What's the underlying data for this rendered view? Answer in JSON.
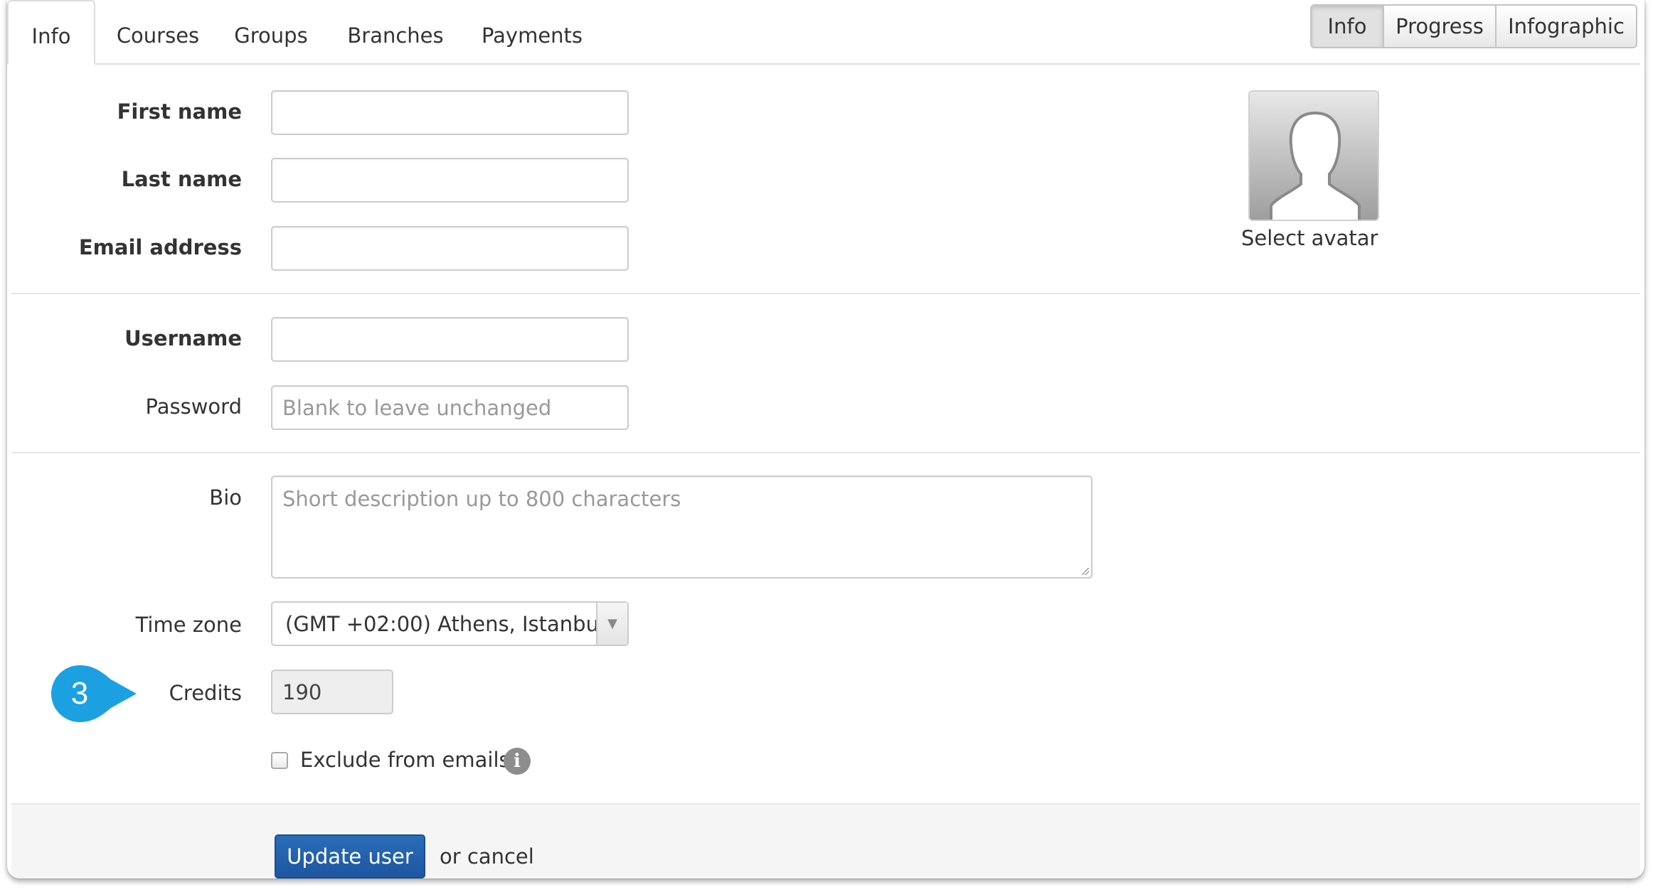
{
  "tabs": [
    {
      "label": "Info",
      "active": true
    },
    {
      "label": "Courses",
      "active": false
    },
    {
      "label": "Groups",
      "active": false
    },
    {
      "label": "Branches",
      "active": false
    },
    {
      "label": "Payments",
      "active": false
    }
  ],
  "view_toggle": [
    {
      "label": "Info",
      "active": true
    },
    {
      "label": "Progress",
      "active": false
    },
    {
      "label": "Infographic",
      "active": false
    }
  ],
  "form": {
    "first_name": {
      "label": "First name",
      "value": ""
    },
    "last_name": {
      "label": "Last name",
      "value": ""
    },
    "email": {
      "label": "Email address",
      "value": ""
    },
    "username": {
      "label": "Username",
      "value": ""
    },
    "password": {
      "label": "Password",
      "placeholder": "Blank to leave unchanged"
    },
    "bio": {
      "label": "Bio",
      "placeholder": "Short description up to 800 characters"
    },
    "timezone": {
      "label": "Time zone",
      "value": "(GMT +02:00) Athens, Istanbu..."
    },
    "credits": {
      "label": "Credits",
      "value": "190"
    },
    "exclude_emails": {
      "label": "Exclude from emails",
      "checked": false
    }
  },
  "avatar": {
    "label": "Select avatar"
  },
  "actions": {
    "update_label": "Update user",
    "cancel_label": "or cancel"
  },
  "callout": {
    "number": "3",
    "color": "#1ba1e2"
  },
  "colors": {
    "primary_button": "#2465ad",
    "accent": "#1ba1e2"
  }
}
